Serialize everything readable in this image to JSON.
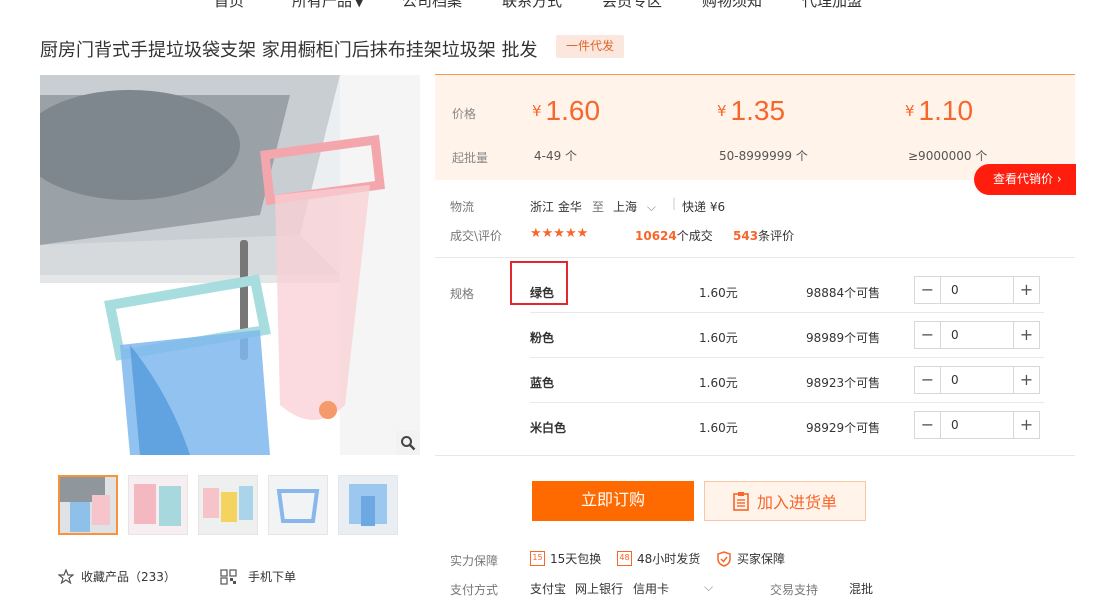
{
  "nav": {
    "items": [
      "首页",
      "所有产品",
      "公司档案",
      "联系方式",
      "会员专区",
      "购物须知",
      "代理加盟"
    ],
    "caret": "▼"
  },
  "product": {
    "title": "厨房门背式手提垃圾袋支架 家用橱柜门后抹布挂架垃圾架 批发",
    "badge": "一件代发"
  },
  "pricing": {
    "price_label": "价格",
    "moq_label": "起批量",
    "currency": "¥",
    "tiers": [
      {
        "price": "1.60",
        "qty": "4-49 个"
      },
      {
        "price": "1.35",
        "qty": "50-8999999 个"
      },
      {
        "price": "1.10",
        "qty": "≥9000000 个"
      }
    ],
    "agent_button": "查看代销价"
  },
  "logistics": {
    "label": "物流",
    "origin": "浙江 金华",
    "to": "至",
    "destination": "上海",
    "express": "快递 ¥6"
  },
  "reviews": {
    "label": "成交\\评价",
    "stars": "★★★★★",
    "deals_count": "10624",
    "deals_suffix": "个成交",
    "reviews_count": "543",
    "reviews_suffix": "条评价"
  },
  "spec": {
    "label": "规格",
    "rows": [
      {
        "name": "绿色",
        "price": "1.60元",
        "stock": "98884个可售",
        "qty": "0"
      },
      {
        "name": "粉色",
        "price": "1.60元",
        "stock": "98989个可售",
        "qty": "0"
      },
      {
        "name": "蓝色",
        "price": "1.60元",
        "stock": "98923个可售",
        "qty": "0"
      },
      {
        "name": "米白色",
        "price": "1.60元",
        "stock": "98929个可售",
        "qty": "0"
      }
    ]
  },
  "actions": {
    "order": "立即订购",
    "cart": "加入进货单"
  },
  "guarantees": {
    "label": "实力保障",
    "items": [
      {
        "icon": "15",
        "text": "15天包换"
      },
      {
        "icon": "48",
        "text": "48小时发货"
      },
      {
        "icon": "shield",
        "text": "买家保障"
      }
    ]
  },
  "payment": {
    "label": "支付方式",
    "methods": [
      "支付宝",
      "网上银行",
      "信用卡"
    ],
    "trade_label": "交易支持",
    "trade_value": "混批"
  },
  "gallery": {
    "favorite": "收藏产品（233）",
    "mobile": "手机下单"
  },
  "colors": {
    "accent": "#ff6a00",
    "price_orange": "#f7662a",
    "agent_red": "#ff1e0e",
    "panel_bg": "#fff3ea",
    "highlight_red": "#e0282e"
  },
  "icons": {
    "zoom": "magnifier-icon",
    "favorite": "star-outline-icon",
    "mobile": "qr-code-icon",
    "cart": "clipboard-icon"
  }
}
